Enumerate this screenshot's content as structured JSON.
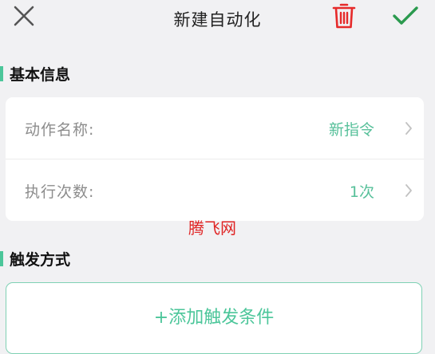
{
  "header": {
    "title": "新建自动化",
    "close_icon": "close-icon",
    "delete_icon": "trash-icon",
    "confirm_icon": "check-icon"
  },
  "sections": {
    "basic_info": {
      "title": "基本信息",
      "rows": [
        {
          "label": "动作名称:",
          "value": "新指令"
        },
        {
          "label": "执行次数:",
          "value": "1次"
        }
      ]
    },
    "trigger": {
      "title": "触发方式",
      "add_button_label": "+添加触发条件"
    }
  },
  "watermark": "腾飞网",
  "colors": {
    "accent": "#4cc69a",
    "delete": "#e62a2a",
    "background": "#f1f1f3"
  }
}
